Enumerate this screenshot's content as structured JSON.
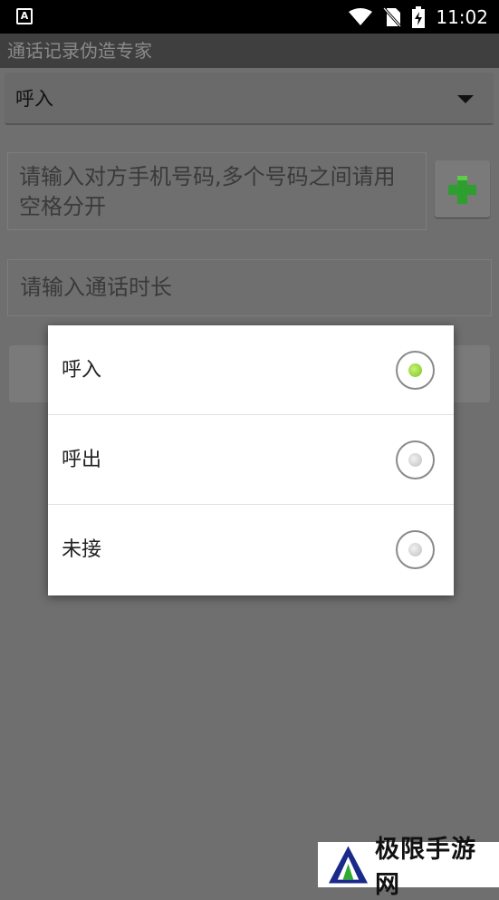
{
  "status_bar": {
    "time": "11:02",
    "app_icon_letter": "A",
    "icons": [
      "wifi-icon",
      "no-sim-icon",
      "battery-charging-icon"
    ]
  },
  "app": {
    "title": "通话记录伪造专家"
  },
  "form": {
    "call_type_selected": "呼入",
    "phone_placeholder": "请输入对方手机号码,多个号码之间请用空格分开",
    "add_icon": "plus-icon",
    "duration_placeholder": "请输入通话时长"
  },
  "dialog": {
    "options": [
      {
        "label": "呼入",
        "selected": true
      },
      {
        "label": "呼出",
        "selected": false
      },
      {
        "label": "未接",
        "selected": false
      }
    ]
  },
  "watermark": {
    "text": "极限手游网"
  },
  "colors": {
    "accent_green": "#7ac41a",
    "plus_green": "#2e9e2e"
  }
}
